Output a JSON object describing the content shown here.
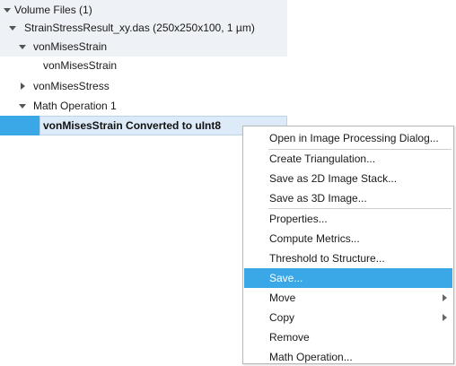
{
  "tree": {
    "root_label": "Volume Files (1)",
    "file_label": "StrainStressResult_xy.das (250x250x100, 1 µm)",
    "strain_group_label": "vonMisesStrain",
    "strain_child_label": "vonMisesStrain",
    "stress_group_label": "vonMisesStress",
    "mathop_label": "Math Operation 1",
    "selected_label": "vonMisesStrain Converted to uInt8"
  },
  "context_menu": {
    "items": [
      {
        "label": "Open in Image Processing Dialog...",
        "highlighted": false,
        "submenu": false
      },
      {
        "label": "Create Triangulation...",
        "highlighted": false,
        "submenu": false
      },
      {
        "label": "Save as 2D Image Stack...",
        "highlighted": false,
        "submenu": false
      },
      {
        "label": "Save as 3D Image...",
        "highlighted": false,
        "submenu": false
      },
      {
        "label": "Properties...",
        "highlighted": false,
        "submenu": false
      },
      {
        "label": "Compute Metrics...",
        "highlighted": false,
        "submenu": false
      },
      {
        "label": "Threshold to Structure...",
        "highlighted": false,
        "submenu": false
      },
      {
        "label": "Save...",
        "highlighted": true,
        "submenu": false
      },
      {
        "label": "Move",
        "highlighted": false,
        "submenu": true
      },
      {
        "label": "Copy",
        "highlighted": false,
        "submenu": true
      },
      {
        "label": "Remove",
        "highlighted": false,
        "submenu": false
      },
      {
        "label": "Math Operation...",
        "highlighted": false,
        "submenu": false
      }
    ]
  },
  "colors": {
    "highlight": "#3aa7e6",
    "selection_bg": "#dcebf7"
  }
}
